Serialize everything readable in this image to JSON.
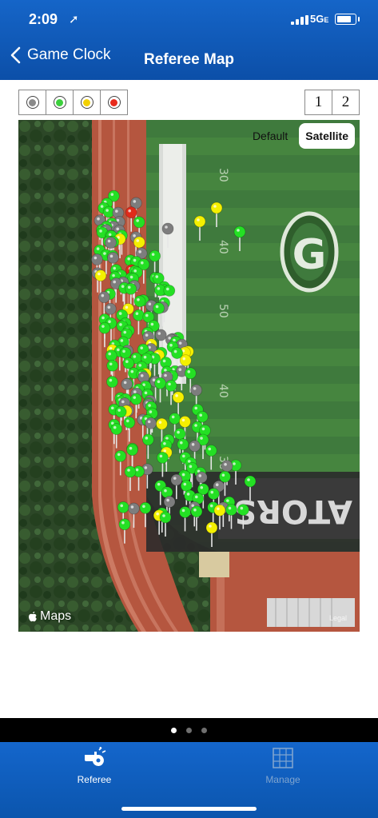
{
  "status": {
    "time": "2:09",
    "network": "5G",
    "network_suffix": "E"
  },
  "nav": {
    "back_label": "Game Clock",
    "title": "Referee Map"
  },
  "filters": [
    {
      "name": "gray",
      "color": "#8a8a8a"
    },
    {
      "name": "green",
      "color": "#3ccf3c"
    },
    {
      "name": "yellow",
      "color": "#f2d000"
    },
    {
      "name": "red",
      "color": "#e82a1c"
    }
  ],
  "pages": [
    "1",
    "2"
  ],
  "map": {
    "mode_default": "Default",
    "mode_satellite": "Satellite",
    "selected_mode": "Satellite",
    "attribution": "Maps",
    "legal": "Legal",
    "field_logo_letter": "G",
    "endzone_text": "ATORS",
    "pin_colors": {
      "green": "#24e024",
      "gray": "#7d7d7d",
      "yellow": "#f4f000",
      "red": "#e02a1a"
    }
  },
  "page_indicator": {
    "count": 3,
    "active": 0
  },
  "tabs": [
    {
      "label": "Referee",
      "icon": "whistle-icon",
      "active": true
    },
    {
      "label": "Manage",
      "icon": "clipboard-grid-icon",
      "active": false
    }
  ]
}
